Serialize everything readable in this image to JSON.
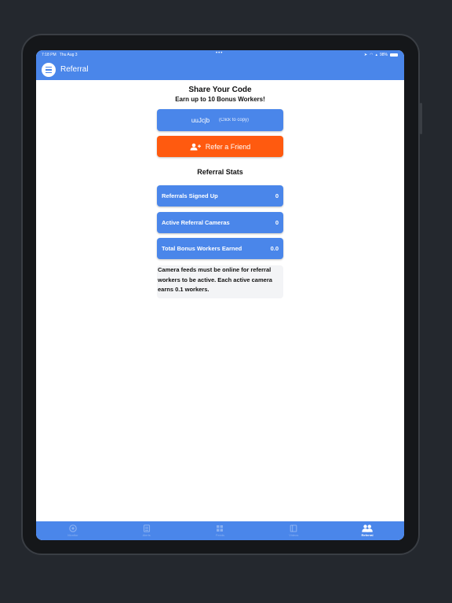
{
  "status_bar": {
    "time": "7:18 PM",
    "date": "Thu Aug 3",
    "dots": "•••",
    "battery": "98%",
    "battery_level": 0.98
  },
  "app_bar": {
    "title": "Referral"
  },
  "share": {
    "heading": "Share Your Code",
    "subheading": "Earn up to 10 Bonus Workers!",
    "code": "uuJcjb",
    "code_hint": "(Click to copy)",
    "refer_label": "Refer a Friend"
  },
  "stats": {
    "title": "Referral Stats",
    "items": [
      {
        "label": "Referrals Signed Up",
        "value": "0"
      },
      {
        "label": "Active Referral Cameras",
        "value": "0"
      },
      {
        "label": "Total Bonus Workers Earned",
        "value": "0.0"
      }
    ]
  },
  "note": "Camera feeds must be online for referral workers to be active. Each active camera earns 0.1 workers.",
  "tabs": [
    {
      "label": "Monitor",
      "icon": "camera-icon"
    },
    {
      "label": "Alerts",
      "icon": "document-icon"
    },
    {
      "label": "Feeds",
      "icon": "grid-icon"
    },
    {
      "label": "Videos",
      "icon": "book-icon"
    },
    {
      "label": "Referral",
      "icon": "people-icon"
    }
  ],
  "colors": {
    "primary": "#4a86ea",
    "accent": "#ff5a0f",
    "device_bg": "#24282e"
  }
}
